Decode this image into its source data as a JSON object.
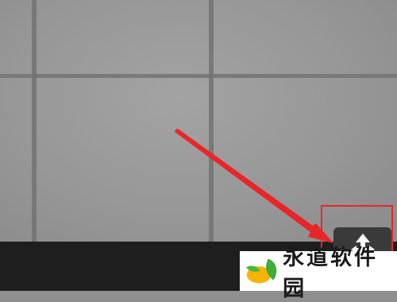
{
  "watermark": {
    "text": "永道软件园"
  },
  "colors": {
    "arrow": "#e8262a",
    "highlight": "#e8262a",
    "taskbar": "#1e1e1e"
  },
  "icons": {
    "tray_button": "move-arrows-icon",
    "annotation": "red-arrow-icon"
  }
}
